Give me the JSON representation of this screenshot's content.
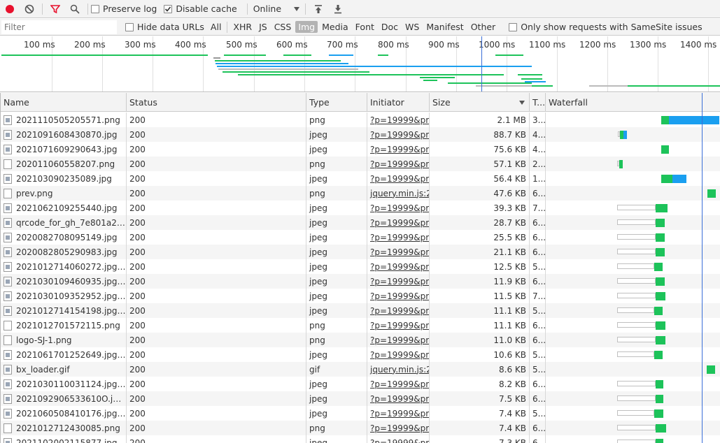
{
  "toolbar": {
    "preserve_log_label": "Preserve log",
    "preserve_log_checked": false,
    "disable_cache_label": "Disable cache",
    "disable_cache_checked": true,
    "throttle_value": "Online"
  },
  "filterbar": {
    "placeholder": "Filter",
    "hide_data_urls_label": "Hide data URLs",
    "types": [
      "All",
      "XHR",
      "JS",
      "CSS",
      "Img",
      "Media",
      "Font",
      "Doc",
      "WS",
      "Manifest",
      "Other"
    ],
    "active_type": "Img",
    "samesite_label": "Only show requests with SameSite issues"
  },
  "overview": {
    "ticks": [
      "100 ms",
      "200 ms",
      "300 ms",
      "400 ms",
      "500 ms",
      "600 ms",
      "700 ms",
      "800 ms",
      "900 ms",
      "1000 ms",
      "1100 ms",
      "1200 ms",
      "1300 ms",
      "1400 ms"
    ]
  },
  "colors": {
    "accent": "#3a6fd8",
    "record": "#e8112d",
    "filter_active": "#e8112d",
    "waterfall_receive": "#1dc35a",
    "waterfall_download": "#1a9ff0"
  },
  "table": {
    "headers": [
      "Name",
      "Status",
      "Type",
      "Initiator",
      "Size",
      "T...",
      "Waterfall"
    ],
    "rows": [
      {
        "name": "2021110505205571.png",
        "status": "200",
        "type": "png",
        "initiator": "?p=19999&pr...",
        "size": "2.1 MB",
        "time": "3..."
      },
      {
        "name": "2021091608430870.jpg",
        "status": "200",
        "type": "jpeg",
        "initiator": "?p=19999&pr...",
        "size": "88.7 KB",
        "time": "4..."
      },
      {
        "name": "2021071609290643.jpg",
        "status": "200",
        "type": "jpeg",
        "initiator": "?p=19999&pr...",
        "size": "75.6 KB",
        "time": "4..."
      },
      {
        "name": "202011060558207.png",
        "status": "200",
        "type": "png",
        "initiator": "?p=19999&pr...",
        "size": "57.1 KB",
        "time": "2..."
      },
      {
        "name": "202103090235089.jpg",
        "status": "200",
        "type": "jpeg",
        "initiator": "?p=19999&pr...",
        "size": "56.4 KB",
        "time": "1..."
      },
      {
        "name": "prev.png",
        "status": "200",
        "type": "png",
        "initiator": "jquery.min.js:2",
        "size": "47.6 KB",
        "time": "6..."
      },
      {
        "name": "2021062109255440.jpg",
        "status": "200",
        "type": "jpeg",
        "initiator": "?p=19999&pr...",
        "size": "39.3 KB",
        "time": "7..."
      },
      {
        "name": "qrcode_for_gh_7e801a2b5d...",
        "status": "200",
        "type": "jpeg",
        "initiator": "?p=19999&pr...",
        "size": "28.7 KB",
        "time": "6..."
      },
      {
        "name": "2020082708095149.jpg",
        "status": "200",
        "type": "jpeg",
        "initiator": "?p=19999&pr...",
        "size": "25.5 KB",
        "time": "6..."
      },
      {
        "name": "2020082805290983.jpg",
        "status": "200",
        "type": "jpeg",
        "initiator": "?p=19999&pr...",
        "size": "21.1 KB",
        "time": "6..."
      },
      {
        "name": "2021012714060272.jpg?x-o...",
        "status": "200",
        "type": "jpeg",
        "initiator": "?p=19999&pr...",
        "size": "12.5 KB",
        "time": "5..."
      },
      {
        "name": "2021030109460935.jpg?x-o...",
        "status": "200",
        "type": "jpeg",
        "initiator": "?p=19999&pr...",
        "size": "11.9 KB",
        "time": "6..."
      },
      {
        "name": "2021030109352952.jpg?x-o...",
        "status": "200",
        "type": "jpeg",
        "initiator": "?p=19999&pr...",
        "size": "11.5 KB",
        "time": "7..."
      },
      {
        "name": "2021012714154198.jpg?x-o...",
        "status": "200",
        "type": "jpeg",
        "initiator": "?p=19999&pr...",
        "size": "11.1 KB",
        "time": "5..."
      },
      {
        "name": "2021012701572115.png",
        "status": "200",
        "type": "png",
        "initiator": "?p=19999&pr...",
        "size": "11.1 KB",
        "time": "6..."
      },
      {
        "name": "logo-SJ-1.png",
        "status": "200",
        "type": "png",
        "initiator": "?p=19999&pr...",
        "size": "11.0 KB",
        "time": "6..."
      },
      {
        "name": "2021061701252649.jpg?x-o...",
        "status": "200",
        "type": "jpeg",
        "initiator": "?p=19999&pr...",
        "size": "10.6 KB",
        "time": "5..."
      },
      {
        "name": "bx_loader.gif",
        "status": "200",
        "type": "gif",
        "initiator": "jquery.min.js:2",
        "size": "8.6 KB",
        "time": "5..."
      },
      {
        "name": "2021030110031124.jpg?x-o...",
        "status": "200",
        "type": "jpeg",
        "initiator": "?p=19999&pr...",
        "size": "8.2 KB",
        "time": "6..."
      },
      {
        "name": "2021092906533610O.jpg?x-...",
        "status": "200",
        "type": "jpeg",
        "initiator": "?p=19999&pr...",
        "size": "7.5 KB",
        "time": "6..."
      },
      {
        "name": "2021060508410176.jpg?x-o...",
        "status": "200",
        "type": "jpeg",
        "initiator": "?p=19999&pr...",
        "size": "7.4 KB",
        "time": "5..."
      },
      {
        "name": "2021012712430085.png",
        "status": "200",
        "type": "png",
        "initiator": "?p=19999&pr...",
        "size": "7.4 KB",
        "time": "6..."
      },
      {
        "name": "2021102002115877.jpg?x-o...",
        "status": "200",
        "type": "jpeg",
        "initiator": "?p=19999&pr...",
        "size": "7.3 KB",
        "time": "6..."
      }
    ]
  }
}
